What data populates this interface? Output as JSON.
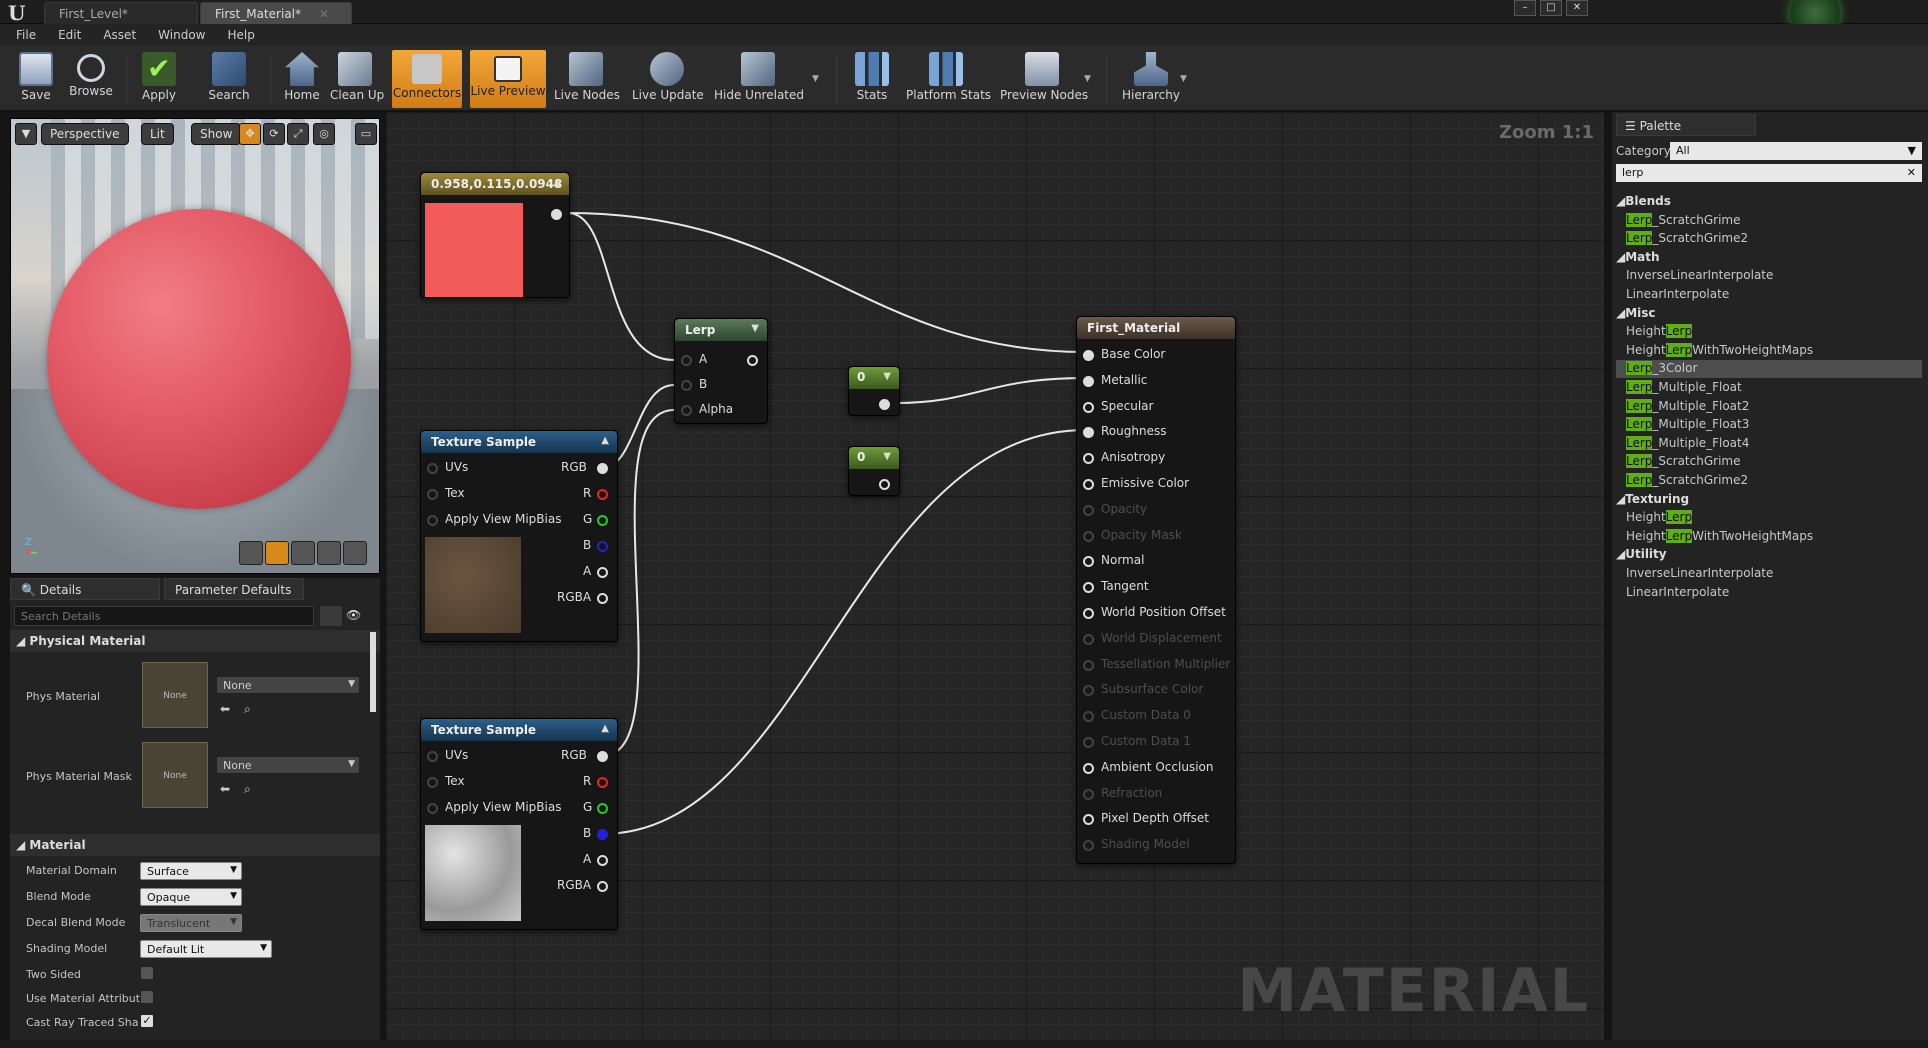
{
  "tabs": [
    {
      "label": "First_Level*",
      "active": false
    },
    {
      "label": "First_Material*",
      "active": true
    }
  ],
  "menu": [
    "File",
    "Edit",
    "Asset",
    "Window",
    "Help"
  ],
  "toolbar": {
    "save": "Save",
    "browse": "Browse",
    "apply": "Apply",
    "search": "Search",
    "home": "Home",
    "clean_up": "Clean Up",
    "connectors": "Connectors",
    "live_preview": "Live Preview",
    "live_nodes": "Live Nodes",
    "live_update": "Live Update",
    "hide_unrelated": "Hide Unrelated",
    "stats": "Stats",
    "platform_stats": "Platform Stats",
    "preview_nodes": "Preview Nodes",
    "hierarchy": "Hierarchy"
  },
  "viewport": {
    "perspective": "Perspective",
    "lit": "Lit",
    "show": "Show"
  },
  "details": {
    "tab_details": "Details",
    "tab_params": "Parameter Defaults",
    "search_placeholder": "Search Details",
    "physical_material": "Physical Material",
    "phys_material": "Phys Material",
    "phys_material_mask": "Phys Material Mask",
    "none": "None",
    "material": "Material",
    "material_domain": "Material Domain",
    "material_domain_val": "Surface",
    "blend_mode": "Blend Mode",
    "blend_mode_val": "Opaque",
    "decal_blend_mode": "Decal Blend Mode",
    "decal_blend_mode_val": "Translucent",
    "shading_model": "Shading Model",
    "shading_model_val": "Default Lit",
    "two_sided": "Two Sided",
    "use_material_attr": "Use Material Attribut",
    "cast_ray": "Cast Ray Traced Sha"
  },
  "graph": {
    "zoom": "Zoom 1:1",
    "watermark": "MATERIAL",
    "color_node": "0.958,0.115,0.0948",
    "lerp": "Lerp",
    "lerp_pins": [
      "A",
      "B",
      "Alpha"
    ],
    "tex1": "Texture Sample",
    "tex2": "Texture Sample",
    "tex_in": [
      "UVs",
      "Tex",
      "Apply View MipBias"
    ],
    "tex_out": [
      "RGB",
      "R",
      "G",
      "B",
      "A",
      "RGBA"
    ],
    "const1": "0",
    "const2": "0",
    "result": "First_Material",
    "result_pins": [
      "Base Color",
      "Metallic",
      "Specular",
      "Roughness",
      "Anisotropy",
      "Emissive Color",
      "Opacity",
      "Opacity Mask",
      "Normal",
      "Tangent",
      "World Position Offset",
      "World Displacement",
      "Tessellation Multiplier",
      "Subsurface Color",
      "Custom Data 0",
      "Custom Data 1",
      "Ambient Occlusion",
      "Refraction",
      "Pixel Depth Offset",
      "Shading Model"
    ]
  },
  "palette": {
    "title": "Palette",
    "category_label": "Category:",
    "category": "All",
    "search": "lerp",
    "groups": [
      {
        "name": "Blends",
        "items": [
          [
            "Lerp",
            "_ScratchGrime"
          ],
          [
            "Lerp",
            "_ScratchGrime2"
          ]
        ]
      },
      {
        "name": "Math",
        "items": [
          [
            "",
            "InverseLinearInterpolate"
          ],
          [
            "",
            "LinearInterpolate"
          ]
        ]
      },
      {
        "name": "Misc",
        "items": [
          [
            "Height",
            "Lerp",
            ""
          ],
          [
            "Height",
            "Lerp",
            "WithTwoHeightMaps"
          ],
          [
            "",
            "Lerp",
            "_3Color"
          ],
          [
            "",
            "Lerp",
            "_Multiple_Float"
          ],
          [
            "",
            "Lerp",
            "_Multiple_Float2"
          ],
          [
            "",
            "Lerp",
            "_Multiple_Float3"
          ],
          [
            "",
            "Lerp",
            "_Multiple_Float4"
          ],
          [
            "",
            "Lerp",
            "_ScratchGrime"
          ],
          [
            "",
            "Lerp",
            "_ScratchGrime2"
          ]
        ]
      },
      {
        "name": "Texturing",
        "items": [
          [
            "Height",
            "Lerp",
            ""
          ],
          [
            "Height",
            "Lerp",
            "WithTwoHeightMaps"
          ]
        ]
      },
      {
        "name": "Utility",
        "items": [
          [
            "",
            "InverseLinearInterpolate"
          ],
          [
            "",
            "LinearInterpolate"
          ]
        ]
      }
    ]
  }
}
